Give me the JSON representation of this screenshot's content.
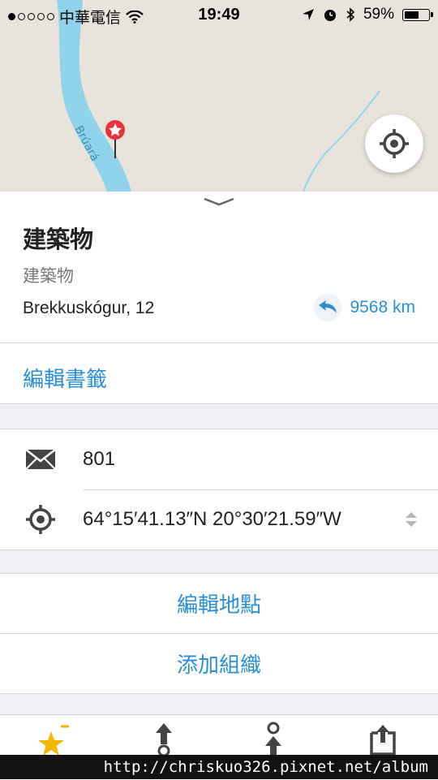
{
  "status": {
    "carrier": "中華電信",
    "time": "19:49",
    "battery": "59%",
    "signal_bars": 1,
    "battery_level": 0.59
  },
  "map": {
    "river_label": "Brúará"
  },
  "place": {
    "title": "建築物",
    "subtitle": "建築物",
    "address": "Brekkuskógur, 12",
    "distance": "9568 km"
  },
  "actions": {
    "edit_bookmark": "編輯書籤",
    "edit_place": "編輯地點",
    "add_organization": "添加組織"
  },
  "details": {
    "postcode": "801",
    "coordinates": "64°15′41.13″N 20°30′21.59″W"
  },
  "tabs": [
    {
      "icon": "bookmark-star-icon"
    },
    {
      "icon": "route-from-icon"
    },
    {
      "icon": "route-to-icon"
    },
    {
      "icon": "share-icon"
    }
  ],
  "watermark": "http://chriskuo326.pixnet.net/album",
  "colors": {
    "accent": "#2a8fd4",
    "river": "#8fd3ec",
    "pin": "#e8333c",
    "star": "#f5b800"
  }
}
